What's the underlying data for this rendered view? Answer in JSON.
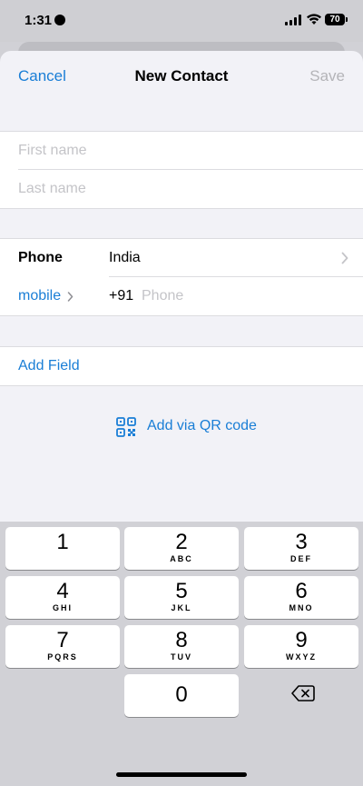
{
  "status_bar": {
    "time": "1:31",
    "battery": "70"
  },
  "nav": {
    "cancel": "Cancel",
    "title": "New Contact",
    "save": "Save"
  },
  "name_fields": {
    "first_placeholder": "First name",
    "last_placeholder": "Last name"
  },
  "phone": {
    "label": "Phone",
    "country": "India",
    "type": "mobile",
    "code": "+91",
    "placeholder": "Phone"
  },
  "add_field": "Add Field",
  "qr": {
    "label": "Add via QR code",
    "icon": "qr-code-icon"
  },
  "keypad": {
    "keys": [
      {
        "digit": "1",
        "letters": ""
      },
      {
        "digit": "2",
        "letters": "ABC"
      },
      {
        "digit": "3",
        "letters": "DEF"
      },
      {
        "digit": "4",
        "letters": "GHI"
      },
      {
        "digit": "5",
        "letters": "JKL"
      },
      {
        "digit": "6",
        "letters": "MNO"
      },
      {
        "digit": "7",
        "letters": "PQRS"
      },
      {
        "digit": "8",
        "letters": "TUV"
      },
      {
        "digit": "9",
        "letters": "WXYZ"
      },
      {
        "digit": "0",
        "letters": ""
      }
    ],
    "delete_icon": "backspace-icon"
  },
  "colors": {
    "accent": "#1a7ed6",
    "placeholder": "#c4c4c8",
    "background": "#f2f2f7"
  }
}
